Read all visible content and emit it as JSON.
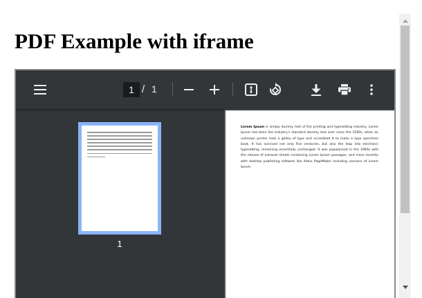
{
  "page": {
    "heading": "PDF Example with iframe"
  },
  "pdf_viewer": {
    "toolbar": {
      "menu_icon": "hamburger-menu-icon",
      "current_page": "1",
      "page_separator": "/",
      "total_pages": "1",
      "zoom_out_icon": "minus-icon",
      "zoom_in_icon": "plus-icon",
      "fit_icon": "fit-to-page-icon",
      "rotate_icon": "rotate-icon",
      "download_icon": "download-icon",
      "print_icon": "print-icon",
      "more_icon": "more-vertical-icon"
    },
    "sidebar": {
      "thumbnail_label": "1"
    },
    "document": {
      "lead": "Lorem Ipsum",
      "body": " is simply dummy text of the printing and typesetting industry. Lorem Ipsum has been the industry's standard dummy text ever since the 1500s, when an unknown printer took a galley of type and scrambled it to make a type specimen book. It has survived not only five centuries, but also the leap into electronic typesetting, remaining essentially unchanged. It was popularised in the 1960s with the release of Letraset sheets containing Lorem Ipsum passages, and more recently with desktop publishing software like Aldus PageMaker including versions of Lorem Ipsum."
    }
  },
  "colors": {
    "toolbar_bg": "#323639",
    "viewer_bg": "#525659",
    "thumbnail_highlight": "#8ab4f8"
  }
}
